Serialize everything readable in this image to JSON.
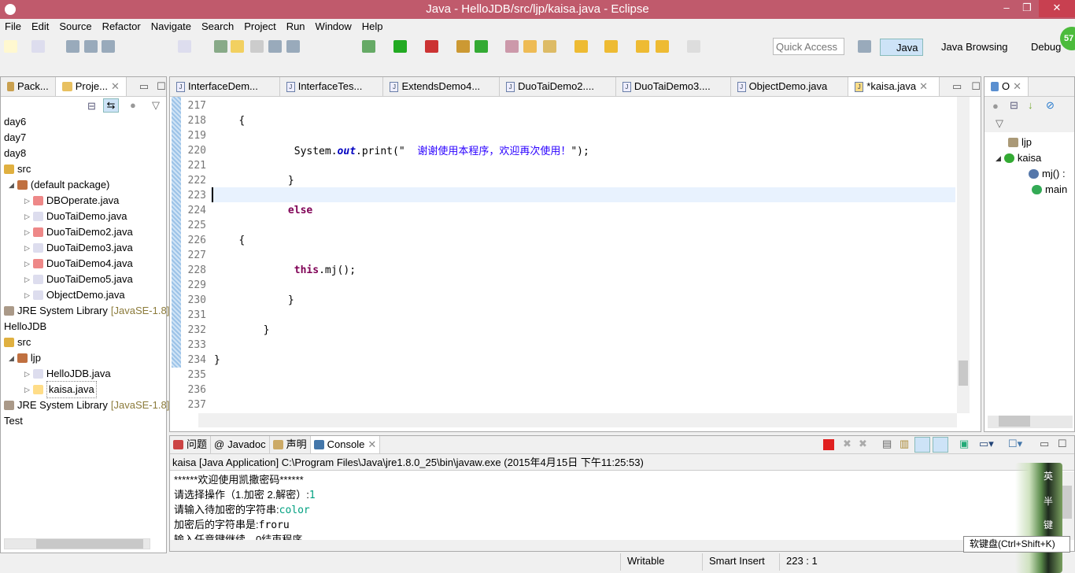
{
  "window": {
    "title": "Java - HelloJDB/src/ljp/kaisa.java - Eclipse",
    "minimize": "–",
    "restore": "❐",
    "close": "✕"
  },
  "menu": [
    "File",
    "Edit",
    "Source",
    "Refactor",
    "Navigate",
    "Search",
    "Project",
    "Run",
    "Window",
    "Help"
  ],
  "toolbar": {
    "quick_access_placeholder": "Quick Access",
    "perspectives": [
      "Java",
      "Java Browsing",
      "Debug"
    ],
    "badge": "57"
  },
  "left_panel": {
    "tabs": [
      "Pack...",
      "Proje..."
    ],
    "tree": [
      {
        "label": "day6",
        "level": 0,
        "icon": "project"
      },
      {
        "label": "day7",
        "level": 0,
        "icon": "project"
      },
      {
        "label": "day8",
        "level": 0,
        "icon": "project"
      },
      {
        "label": "src",
        "level": 0,
        "icon": "source-folder"
      },
      {
        "label": "(default package)",
        "level": 1,
        "icon": "package"
      },
      {
        "label": "DBOperate.java",
        "level": 2,
        "icon": "java-file-error"
      },
      {
        "label": "DuoTaiDemo.java",
        "level": 2,
        "icon": "java-file"
      },
      {
        "label": "DuoTaiDemo2.java",
        "level": 2,
        "icon": "java-file-error"
      },
      {
        "label": "DuoTaiDemo3.java",
        "level": 2,
        "icon": "java-file"
      },
      {
        "label": "DuoTaiDemo4.java",
        "level": 2,
        "icon": "java-file-error"
      },
      {
        "label": "DuoTaiDemo5.java",
        "level": 2,
        "icon": "java-file"
      },
      {
        "label": "ObjectDemo.java",
        "level": 2,
        "icon": "java-file"
      },
      {
        "label": "JRE System Library",
        "suffix": "[JavaSE-1.8]",
        "level": 0,
        "icon": "library"
      },
      {
        "label": "HelloJDB",
        "level": 0,
        "icon": "project"
      },
      {
        "label": "src",
        "level": 0,
        "icon": "source-folder"
      },
      {
        "label": "ljp",
        "level": 1,
        "icon": "package"
      },
      {
        "label": "HelloJDB.java",
        "level": 2,
        "icon": "java-file"
      },
      {
        "label": "kaisa.java",
        "level": 2,
        "icon": "java-file-warning",
        "selected": true
      },
      {
        "label": "JRE System Library",
        "suffix": "[JavaSE-1.8]",
        "level": 0,
        "icon": "library"
      },
      {
        "label": "Test",
        "level": 0,
        "icon": "project"
      }
    ]
  },
  "editor": {
    "tabs": [
      "InterfaceDem...",
      "InterfaceTes...",
      "ExtendsDemo4...",
      "DuoTaiDemo2....",
      "DuoTaiDemo3....",
      "ObjectDemo.java",
      "*kaisa.java"
    ],
    "lines": [
      {
        "n": "217",
        "indent": "",
        "parts": []
      },
      {
        "n": "218",
        "indent": "    ",
        "parts": [
          {
            "t": "{"
          }
        ]
      },
      {
        "n": "219",
        "indent": "",
        "parts": []
      },
      {
        "n": "220",
        "indent": "             ",
        "parts": [
          {
            "t": "System."
          },
          {
            "t": "out",
            "c": "fld"
          },
          {
            "t": ".print(\"  "
          },
          {
            "t": "谢谢使用本程序，欢迎再次使用！",
            "c": "str"
          },
          {
            "t": "\");"
          }
        ]
      },
      {
        "n": "221",
        "indent": "",
        "parts": []
      },
      {
        "n": "222",
        "indent": "            ",
        "parts": [
          {
            "t": "}"
          }
        ]
      },
      {
        "n": "223",
        "indent": "",
        "parts": []
      },
      {
        "n": "224",
        "indent": "            ",
        "parts": [
          {
            "t": "else",
            "c": "kw"
          }
        ]
      },
      {
        "n": "225",
        "indent": "",
        "parts": []
      },
      {
        "n": "226",
        "indent": "    ",
        "parts": [
          {
            "t": "{"
          }
        ]
      },
      {
        "n": "227",
        "indent": "",
        "parts": []
      },
      {
        "n": "228",
        "indent": "             ",
        "parts": [
          {
            "t": "this",
            "c": "kw"
          },
          {
            "t": ".mj();"
          }
        ]
      },
      {
        "n": "229",
        "indent": "",
        "parts": []
      },
      {
        "n": "230",
        "indent": "            ",
        "parts": [
          {
            "t": "}"
          }
        ]
      },
      {
        "n": "231",
        "indent": "",
        "parts": []
      },
      {
        "n": "232",
        "indent": "        ",
        "parts": [
          {
            "t": "}"
          }
        ]
      },
      {
        "n": "233",
        "indent": "",
        "parts": []
      },
      {
        "n": "234",
        "indent": "",
        "parts": [
          {
            "t": "}"
          }
        ]
      },
      {
        "n": "235",
        "indent": "",
        "parts": []
      },
      {
        "n": "236",
        "indent": "",
        "parts": []
      },
      {
        "n": "237",
        "indent": "",
        "parts": []
      }
    ]
  },
  "outline": {
    "tab": "O",
    "items": [
      {
        "label": "ljp",
        "icon": "package"
      },
      {
        "label": "kaisa",
        "icon": "class"
      },
      {
        "label": "mj() :",
        "icon": "method-warning"
      },
      {
        "label": "main",
        "icon": "static-method"
      }
    ]
  },
  "console": {
    "tabs": [
      "问题",
      "Javadoc",
      "声明",
      "Console"
    ],
    "header": "kaisa [Java Application] C:\\Program Files\\Java\\jre1.8.0_25\\bin\\javaw.exe (2015年4月15日 下午11:25:53)",
    "lines": [
      {
        "text": "******欢迎使用凯撒密码******"
      },
      {
        "text": "请选择操作（1.加密 2.解密）:",
        "input": "1"
      },
      {
        "text": "请输入待加密的字符串:",
        "input": "color"
      },
      {
        "text": "加密后的字符串是:",
        "output": "froru"
      },
      {
        "text": "输入任意键继续，0结束程序"
      }
    ]
  },
  "ime": {
    "tooltip": "软键盘(Ctrl+Shift+K)",
    "labels": [
      "英",
      "半",
      "键"
    ]
  },
  "status": {
    "writable": "Writable",
    "insert_mode": "Smart Insert",
    "position": "223 : 1"
  }
}
